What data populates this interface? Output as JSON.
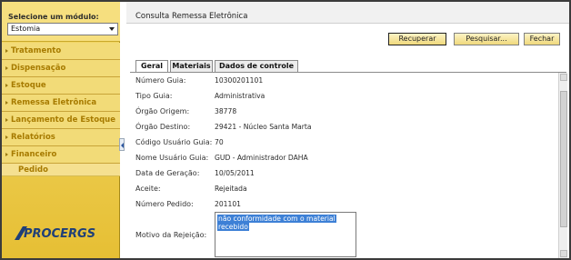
{
  "sidebar": {
    "module_label": "Selecione um módulo:",
    "module_value": "Estomia",
    "menu": [
      {
        "label": "Tratamento"
      },
      {
        "label": "Dispensação"
      },
      {
        "label": "Estoque"
      },
      {
        "label": "Remessa Eletrônica"
      },
      {
        "label": "Lançamento de Estoque"
      },
      {
        "label": "Relatórios"
      },
      {
        "label": "Financeiro"
      }
    ],
    "submenu": [
      {
        "label": "Pedido"
      }
    ],
    "logo": "PROCERGS"
  },
  "main": {
    "title": "Consulta Remessa Eletrônica",
    "buttons": {
      "recuperar": "Recuperar",
      "pesquisar": "Pesquisar...",
      "fechar": "Fechar"
    },
    "tabs": [
      {
        "label": "Geral"
      },
      {
        "label": "Materiais"
      },
      {
        "label": "Dados de controle"
      }
    ],
    "fields": [
      {
        "label": "Número Guia:",
        "value": "10300201101"
      },
      {
        "label": "Tipo Guia:",
        "value": "Administrativa"
      },
      {
        "label": "Órgão Origem:",
        "value": "38778"
      },
      {
        "label": "Órgão Destino:",
        "value": "29421 - Núcleo Santa Marta"
      },
      {
        "label": "Código Usuário Guia:",
        "value": "70"
      },
      {
        "label": "Nome Usuário Guia:",
        "value": "GUD - Administrador DAHA"
      },
      {
        "label": "Data de Geração:",
        "value": "10/05/2011"
      },
      {
        "label": "Aceite:",
        "value": "Rejeitada"
      },
      {
        "label": "Número Pedido:",
        "value": "201101"
      }
    ],
    "motivo": {
      "label": "Motivo da Rejeição:",
      "line1": "não conformidade com o material",
      "line2": "recebido"
    }
  }
}
